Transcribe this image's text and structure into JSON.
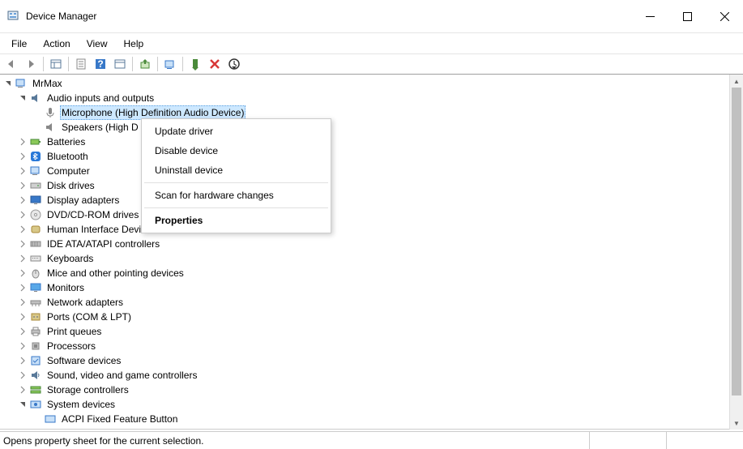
{
  "window": {
    "title": "Device Manager"
  },
  "menubar": [
    "File",
    "Action",
    "View",
    "Help"
  ],
  "root_node": "MrMax",
  "categories": [
    {
      "label": "Audio inputs and outputs",
      "expanded": true,
      "icon": "audio-icon",
      "children": [
        {
          "label": "Microphone (High Definition Audio Device)",
          "icon": "mic-icon",
          "selected": true
        },
        {
          "label": "Speakers (High Definition Audio Device)",
          "icon": "speaker-icon",
          "truncated": "Speakers (High D"
        }
      ]
    },
    {
      "label": "Batteries",
      "icon": "battery-icon"
    },
    {
      "label": "Bluetooth",
      "icon": "bluetooth-icon"
    },
    {
      "label": "Computer",
      "icon": "computer-icon"
    },
    {
      "label": "Disk drives",
      "icon": "disk-icon"
    },
    {
      "label": "Display adapters",
      "icon": "display-icon"
    },
    {
      "label": "DVD/CD-ROM drives",
      "icon": "cd-icon"
    },
    {
      "label": "Human Interface Devices",
      "icon": "hid-icon"
    },
    {
      "label": "IDE ATA/ATAPI controllers",
      "icon": "ide-icon"
    },
    {
      "label": "Keyboards",
      "icon": "keyboard-icon"
    },
    {
      "label": "Mice and other pointing devices",
      "icon": "mouse-icon"
    },
    {
      "label": "Monitors",
      "icon": "monitor-icon"
    },
    {
      "label": "Network adapters",
      "icon": "network-icon"
    },
    {
      "label": "Ports (COM & LPT)",
      "icon": "port-icon"
    },
    {
      "label": "Print queues",
      "icon": "printer-icon"
    },
    {
      "label": "Processors",
      "icon": "cpu-icon"
    },
    {
      "label": "Software devices",
      "icon": "software-icon"
    },
    {
      "label": "Sound, video and game controllers",
      "icon": "sound-icon"
    },
    {
      "label": "Storage controllers",
      "icon": "storage-icon"
    },
    {
      "label": "System devices",
      "expanded": true,
      "icon": "system-icon",
      "children": [
        {
          "label": "ACPI Fixed Feature Button",
          "icon": "acpi-icon"
        }
      ]
    }
  ],
  "context_menu": {
    "items": [
      {
        "label": "Update driver"
      },
      {
        "label": "Disable device"
      },
      {
        "label": "Uninstall device"
      },
      {
        "sep": true
      },
      {
        "label": "Scan for hardware changes"
      },
      {
        "sep": true
      },
      {
        "label": "Properties",
        "bold": true
      }
    ]
  },
  "statusbar": {
    "text": "Opens property sheet for the current selection."
  }
}
